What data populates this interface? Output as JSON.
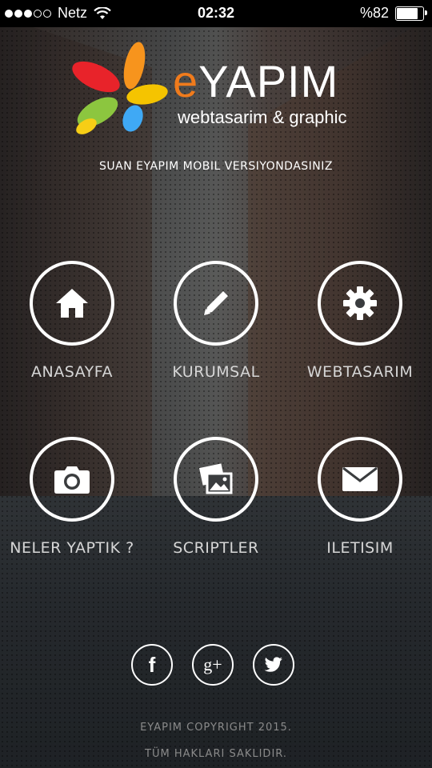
{
  "status_bar": {
    "carrier": "Netz",
    "time": "02:32",
    "battery_text": "%82",
    "battery_level": 0.82,
    "signal_dots_filled": 3,
    "signal_dots_total": 5
  },
  "logo": {
    "word_first": "e",
    "word_rest": "YAPIM",
    "subtitle": "webtasarim & graphic"
  },
  "tagline": "SUAN EYAPIM MOBIL VERSIYONDASINIZ",
  "menu": {
    "items": [
      {
        "label": "ANASAYFA",
        "icon": "home-icon"
      },
      {
        "label": "KURUMSAL",
        "icon": "pencil-icon"
      },
      {
        "label": "WEBTASARIM",
        "icon": "gear-icon"
      },
      {
        "label": "NELER YAPTIK ?",
        "icon": "camera-icon"
      },
      {
        "label": "SCRIPTLER",
        "icon": "images-icon"
      },
      {
        "label": "ILETISIM",
        "icon": "envelope-icon"
      }
    ]
  },
  "social": {
    "facebook": "f",
    "googleplus": "g+",
    "twitter_icon": "twitter-icon"
  },
  "footer": {
    "line1": "EYAPIM COPYRIGHT 2015.",
    "line2": "TÜM HAKLARI SAKLIDIR."
  },
  "colors": {
    "logo_orange": "#f07b1c",
    "text_white": "#ffffff",
    "label_gray": "#d6d6d6",
    "footer_gray": "#8a8a8a"
  }
}
